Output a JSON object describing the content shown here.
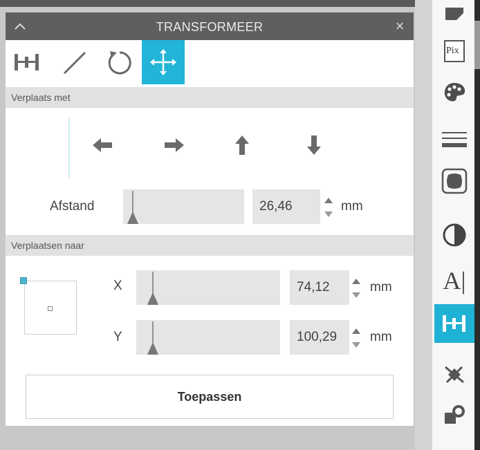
{
  "panel": {
    "title": "TRANSFORMEER",
    "close_glyph": "×"
  },
  "tools": [
    {
      "icon": "align-icon",
      "active": false
    },
    {
      "icon": "scale-icon",
      "active": false
    },
    {
      "icon": "rotate-icon",
      "active": false
    },
    {
      "icon": "move-icon",
      "active": true
    }
  ],
  "move_by": {
    "section_label": "Verplaats met",
    "arrows": [
      "arrow-left-icon",
      "arrow-right-icon",
      "arrow-up-icon",
      "arrow-down-icon"
    ],
    "distance_label": "Afstand",
    "distance_value": "26,46",
    "distance_unit": "mm"
  },
  "move_to": {
    "section_label": "Verplaatsen naar",
    "x_label": "X",
    "x_value": "74,12",
    "x_unit": "mm",
    "y_label": "Y",
    "y_value": "100,29",
    "y_unit": "mm"
  },
  "apply_label": "Toepassen",
  "right_toolbar": {
    "pix_label": "Pix",
    "text_tool_label": "A|",
    "items": [
      "send-icon",
      "pixscan-icon",
      "palette-icon",
      "line-style-icon",
      "offset-icon",
      "contrast-icon",
      "text-icon",
      "transform-icon",
      "trace-icon",
      "replicate-icon"
    ]
  },
  "colors": {
    "accent": "#22b5d7",
    "titlebar": "#5f5f5f",
    "section_bg": "#e1e1e1"
  }
}
